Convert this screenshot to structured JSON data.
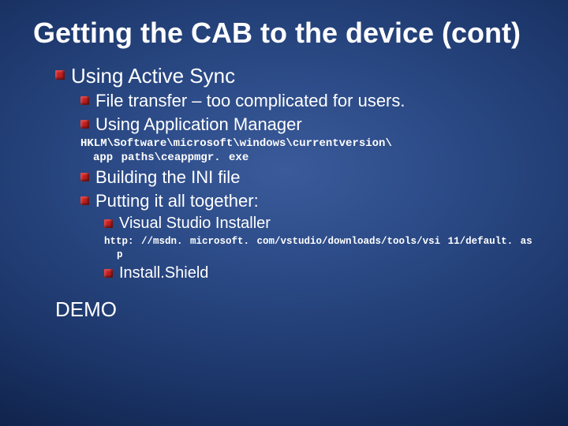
{
  "title": "Getting the CAB to the device (cont)",
  "lvl1_using_active_sync": "Using Active Sync",
  "lvl2_file_transfer": "File transfer – too complicated for users.",
  "lvl2_app_manager": "Using Application Manager",
  "mono_reg_line1": "HKLM\\Software\\microsoft\\windows\\currentversion\\",
  "mono_reg_line2": "app paths\\ceappmgr. exe",
  "lvl2_building_ini": "Building the INI file",
  "lvl2_putting_together": "Putting it all together:",
  "lvl3_vs_installer": "Visual Studio Installer",
  "mono_url_line1": "http: //msdn. microsoft. com/vstudio/downloads/tools/vsi 11/default. as",
  "mono_url_line2": "p",
  "lvl3_installshield": "Install.Shield",
  "demo": "DEMO"
}
